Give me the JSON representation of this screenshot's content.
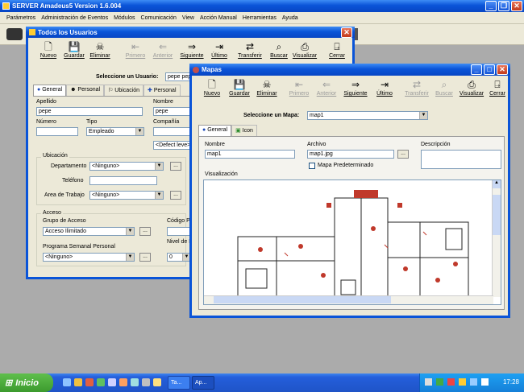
{
  "main_window": {
    "title": "SERVER Amadeus5  Version 1.6.004"
  },
  "menu": [
    "Parámetros",
    "Administración de Eventos",
    "Módulos",
    "Comunicación",
    "View",
    "Acción Manual",
    "Herramientas",
    "Ayuda"
  ],
  "usuarios": {
    "title": "Todos los Usuarios",
    "toolbar": [
      "Nuevo",
      "Guardar",
      "Eliminar",
      "Primero",
      "Anterior",
      "Siguiente",
      "Último",
      "Transferir",
      "Buscar",
      "Visualizar",
      "Cerrar"
    ],
    "select_label": "Seleccione un Usuario:",
    "select_value": "pepe pepe",
    "tabs": [
      "General",
      "Personal",
      "Ubicación",
      "Personal"
    ],
    "apellido_label": "Apellido",
    "apellido_value": "pepe",
    "nombre_label": "Nombre",
    "nombre_value": "pepe",
    "numero_label": "Número",
    "tipo_label": "Tipo",
    "tipo_value": "Empleado",
    "compania_label": "Compañía",
    "compania_value": "<Defect leve>",
    "ubicacion_label": "Ubicación",
    "departamento_label": "Departamento",
    "departamento_value": "<Ninguno>",
    "telefono_label": "Teléfono",
    "area_label": "Area de Trabajo",
    "area_value": "<Ninguno>",
    "acceso_label": "Acceso",
    "grupo_label": "Grupo de Acceso",
    "grupo_value": "Acceso Ilimitado",
    "programa_label": "Programa Semanal Personal",
    "programa_value": "<Ninguno>",
    "codigo_label": "Código PIN",
    "nivel_label": "Nivel de Priorid",
    "nivel_value": "0"
  },
  "mapas": {
    "title": "Mapas",
    "toolbar": [
      "Nuevo",
      "Guardar",
      "Eliminar",
      "Primero",
      "Anterior",
      "Siguiente",
      "Último",
      "Transferir",
      "Buscar",
      "Visualizar",
      "Cerrar"
    ],
    "select_label": "Seleccione un Mapa:",
    "select_value": "map1",
    "tabs": [
      "General",
      "Icon"
    ],
    "nombre_label": "Nombre",
    "nombre_value": "map1",
    "archivo_label": "Archivo",
    "archivo_value": "map1.jpg",
    "descripcion_label": "Descripción",
    "checkbox_label": "Mapa Predeterminado",
    "visualizacion_label": "Visualización"
  },
  "taskbar": {
    "start_label": "Inicio",
    "items": [
      "Ta...",
      "Ap..."
    ],
    "clock": "17:28"
  },
  "colors": {
    "titlebar": "#0a54d8",
    "taskbar": "#245edb",
    "start": "#3c9a2e",
    "window_bg": "#ece9d8"
  }
}
